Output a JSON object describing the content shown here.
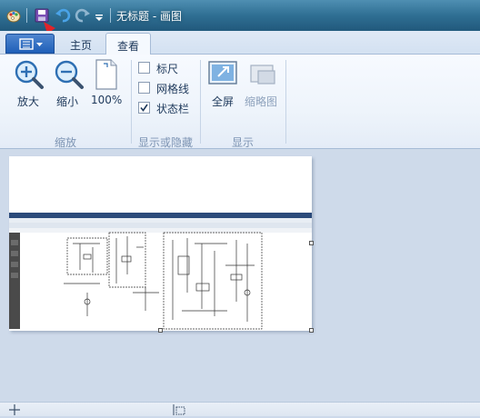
{
  "window": {
    "title": "无标题 - 画图"
  },
  "tabs": [
    {
      "label": "主页"
    },
    {
      "label": "查看"
    }
  ],
  "ribbon": {
    "zoom_group": {
      "label": "缩放",
      "zoom_in": "放大",
      "zoom_out": "缩小",
      "actual_size": "100%"
    },
    "show_hide_group": {
      "label": "显示或隐藏",
      "ruler": {
        "label": "标尺",
        "checked": false
      },
      "gridlines": {
        "label": "网格线",
        "checked": false
      },
      "statusbar": {
        "label": "状态栏",
        "checked": true
      }
    },
    "display_group": {
      "label": "显示",
      "fullscreen": "全屏",
      "thumbnail": "缩略图"
    }
  },
  "colors": {
    "annotation_arrow": "#e0242a",
    "titlebar": "#2f6f93",
    "ribbon_bg": "#eef4fb",
    "workspace_bg": "#cedaea"
  },
  "icons": {
    "app_icon": "paint-app-icon",
    "save": "save-icon",
    "undo": "undo-icon",
    "redo": "redo-icon",
    "customize": "dropdown-arrow-icon",
    "zoom_in": "magnifier-plus-icon",
    "zoom_out": "magnifier-minus-icon",
    "actual_size": "page-100-icon",
    "fullscreen": "fullscreen-icon",
    "thumbnail": "thumbnail-icon",
    "cursor_position": "crosshair-icon",
    "selection_size": "selection-size-icon"
  }
}
